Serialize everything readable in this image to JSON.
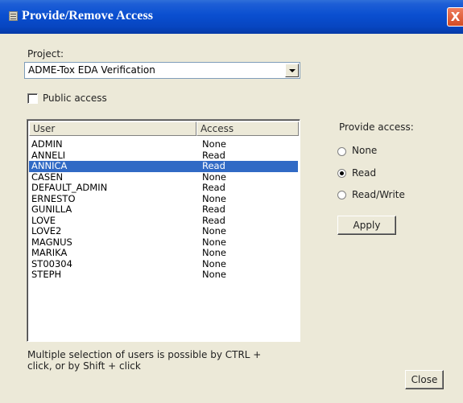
{
  "window": {
    "title": "Provide/Remove Access",
    "close_glyph": "X"
  },
  "project": {
    "label": "Project:",
    "selected": "ADME-Tox EDA Verification"
  },
  "public_access": {
    "label": "Public access",
    "checked": false
  },
  "users_list": {
    "columns": [
      "User",
      "Access"
    ],
    "rows": [
      {
        "user": "ADMIN",
        "access": "None",
        "selected": false
      },
      {
        "user": "ANNELI",
        "access": "Read",
        "selected": false
      },
      {
        "user": "ANNICA",
        "access": "Read",
        "selected": true
      },
      {
        "user": "CASEN",
        "access": "None",
        "selected": false
      },
      {
        "user": "DEFAULT_ADMIN",
        "access": "Read",
        "selected": false
      },
      {
        "user": "ERNESTO",
        "access": "None",
        "selected": false
      },
      {
        "user": "GUNILLA",
        "access": "Read",
        "selected": false
      },
      {
        "user": "LOVE",
        "access": "Read",
        "selected": false
      },
      {
        "user": "LOVE2",
        "access": "None",
        "selected": false
      },
      {
        "user": "MAGNUS",
        "access": "None",
        "selected": false
      },
      {
        "user": "MARIKA",
        "access": "None",
        "selected": false
      },
      {
        "user": "ST00304",
        "access": "None",
        "selected": false
      },
      {
        "user": "STEPH",
        "access": "None",
        "selected": false
      }
    ]
  },
  "provide_access": {
    "label": "Provide access:",
    "options": [
      {
        "label": "None",
        "checked": false
      },
      {
        "label": "Read",
        "checked": true
      },
      {
        "label": "Read/Write",
        "checked": false
      }
    ],
    "apply_label": "Apply"
  },
  "hint": {
    "line1": "Multiple selection of users is possible by CTRL +",
    "line2": "click, or by Shift + click"
  },
  "footer": {
    "close_label": "Close"
  },
  "colors": {
    "titlebar": "#0a4fd0",
    "selection": "#316ac5",
    "dialog_bg": "#ece9d8"
  }
}
